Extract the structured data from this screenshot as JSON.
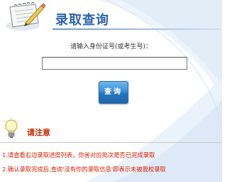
{
  "header": {
    "title": "录取查询"
  },
  "form": {
    "prompt": "请输入身份证号(或考生号)：",
    "input_value": "",
    "button_label": "查询"
  },
  "notice": {
    "title": "请注意",
    "items": [
      "1.请查看右边录取进度列表，你省对应批次是否已完成录取",
      "2.确认录取完成后,查询'没有你的录取信息'即表示未被我校录取"
    ]
  },
  "colors": {
    "title": "#2a62b0",
    "notice_text": "#e02000",
    "button": "#2676c0"
  },
  "icons": {
    "header": "notebook-pencil-icon",
    "notice": "lightbulb-icon"
  }
}
